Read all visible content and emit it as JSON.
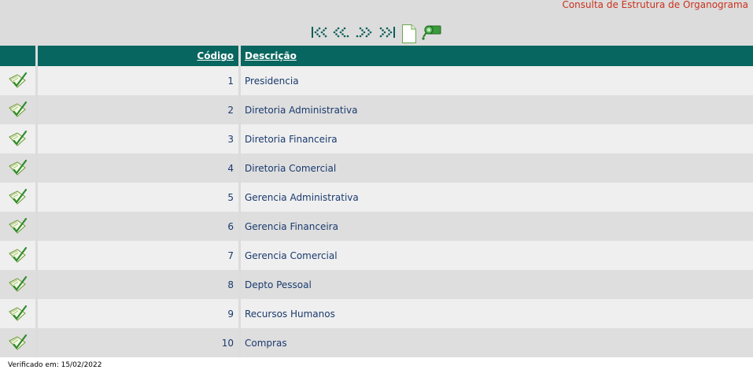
{
  "page": {
    "title": "Consulta de Estrutura de Organograma"
  },
  "toolbar": {
    "icons": [
      "first-page-icon",
      "previous-page-icon",
      "next-page-icon",
      "last-page-icon",
      "new-document-icon",
      "search-icon"
    ]
  },
  "table": {
    "headers": {
      "codigo": "Código",
      "descricao": "Descrição"
    },
    "rows": [
      {
        "codigo": "1",
        "descricao": "Presidencia"
      },
      {
        "codigo": "2",
        "descricao": "Diretoria Administrativa"
      },
      {
        "codigo": "3",
        "descricao": "Diretoria Financeira"
      },
      {
        "codigo": "4",
        "descricao": "Diretoria Comercial"
      },
      {
        "codigo": "5",
        "descricao": "Gerencia Administrativa"
      },
      {
        "codigo": "6",
        "descricao": "Gerencia Financeira"
      },
      {
        "codigo": "7",
        "descricao": "Gerencia Comercial"
      },
      {
        "codigo": "8",
        "descricao": "Depto Pessoal"
      },
      {
        "codigo": "9",
        "descricao": "Recursos Humanos"
      },
      {
        "codigo": "10",
        "descricao": "Compras"
      }
    ]
  },
  "footer": {
    "verified": "Verificado em: 15/02/2022"
  },
  "colors": {
    "header_bg": "#07665f",
    "title": "#c8321e",
    "row_odd": "#efefef",
    "row_even": "#dedede",
    "link_text": "#1a3a6e"
  }
}
